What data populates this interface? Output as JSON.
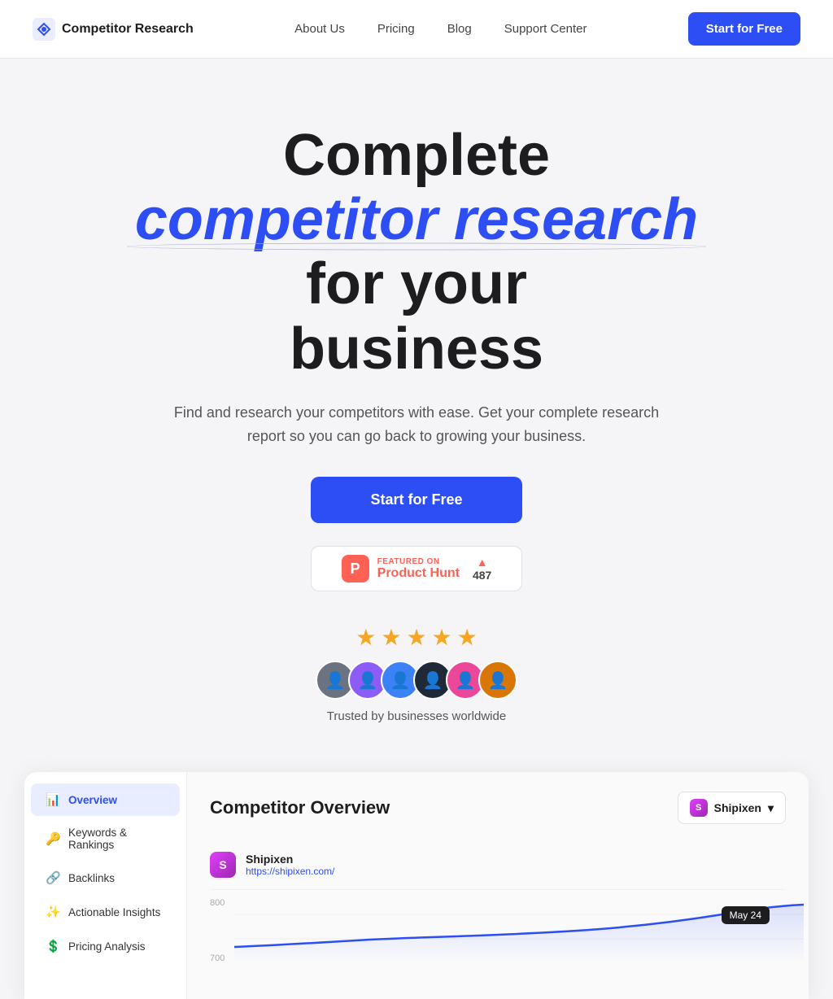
{
  "navbar": {
    "brand_name": "Competitor Research",
    "links": [
      {
        "label": "About Us",
        "id": "about"
      },
      {
        "label": "Pricing",
        "id": "pricing"
      },
      {
        "label": "Blog",
        "id": "blog"
      },
      {
        "label": "Support Center",
        "id": "support"
      }
    ],
    "cta_label": "Start for Free"
  },
  "hero": {
    "title_part1": "Complete",
    "title_highlight": "competitor research",
    "title_part2": "for your",
    "title_part3": "business",
    "subtitle": "Find and research your competitors with ease. Get your complete research report so you can go back to growing your business.",
    "cta_label": "Start for Free",
    "product_hunt": {
      "featured_on": "FEATURED ON",
      "name": "Product Hunt",
      "count": "487",
      "logo_letter": "P"
    },
    "stars_count": 5,
    "trusted_text": "Trusted by businesses worldwide"
  },
  "app_preview": {
    "title": "Competitor Overview",
    "selector_name": "Shipixen",
    "sidebar_items": [
      {
        "label": "Overview",
        "icon": "📊",
        "active": true
      },
      {
        "label": "Keywords & Rankings",
        "icon": "🔑",
        "active": false
      },
      {
        "label": "Backlinks",
        "icon": "🔗",
        "active": false
      },
      {
        "label": "Actionable Insights",
        "icon": "✨",
        "active": false
      },
      {
        "label": "Pricing Analysis",
        "icon": "💲",
        "active": false
      }
    ],
    "competitor": {
      "name": "Shipixen",
      "url": "https://shipixen.com/"
    },
    "chart": {
      "y_labels": [
        "800",
        "700"
      ],
      "date_badge": "May 24"
    }
  }
}
